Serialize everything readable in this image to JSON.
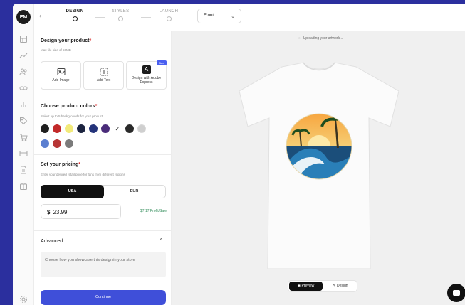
{
  "colors": {
    "background": "#2b2f9e",
    "accent": "#3f4fd9",
    "profit": "#2e8b57",
    "new_badge": "#4a5ff0"
  },
  "avatar": {
    "initials": "EM"
  },
  "rail_icons": [
    "panel-icon",
    "trend-icon",
    "people-icon",
    "link-icon",
    "bar-chart-icon",
    "tag-icon",
    "cart-icon",
    "card-icon",
    "document-icon",
    "box-icon",
    "settings-icon"
  ],
  "steps": [
    {
      "label": "DESIGN",
      "active": true
    },
    {
      "label": "STYLES",
      "active": false
    },
    {
      "label": "LAUNCH",
      "active": false
    }
  ],
  "view_select": {
    "value": "Front"
  },
  "design": {
    "title": "Design your product",
    "required_mark": "*",
    "subtitle": "Max file size of 50MB",
    "tiles": [
      {
        "label": "Add Image",
        "icon": "image-icon"
      },
      {
        "label": "Add Text",
        "icon": "text-icon"
      },
      {
        "label": "Design with Adobe Express",
        "icon": "adobe-express-icon",
        "badge": "New"
      }
    ]
  },
  "colors_section": {
    "title": "Choose product colors",
    "required_mark": "*",
    "subtitle": "Select up to 5 backgrounds for your product",
    "swatches": [
      "#1f1f1f",
      "#c22a2a",
      "#f2ea7a",
      "#1c2440",
      "#24337a",
      "#4a2c7a",
      "#ffffff",
      "#2a2a2a",
      "#cfcfcf",
      "#5b7fd0",
      "#b73535",
      "#7b7b7b"
    ],
    "selected_index": 6
  },
  "pricing": {
    "title": "Set your pricing",
    "required_mark": "*",
    "subtitle": "Enter your desired retail price for fans from different regions",
    "currencies": [
      "USA",
      "EUR"
    ],
    "currency_symbol": "$",
    "price": "23.99",
    "profit": "$7.17 Profit/Sale"
  },
  "advanced": {
    "title": "Advanced",
    "description": "Choose how you showcase this design in your store"
  },
  "continue_label": "Continue",
  "preview": {
    "status": "Uploading your artwork...",
    "tabs": [
      "Preview",
      "Design"
    ]
  }
}
